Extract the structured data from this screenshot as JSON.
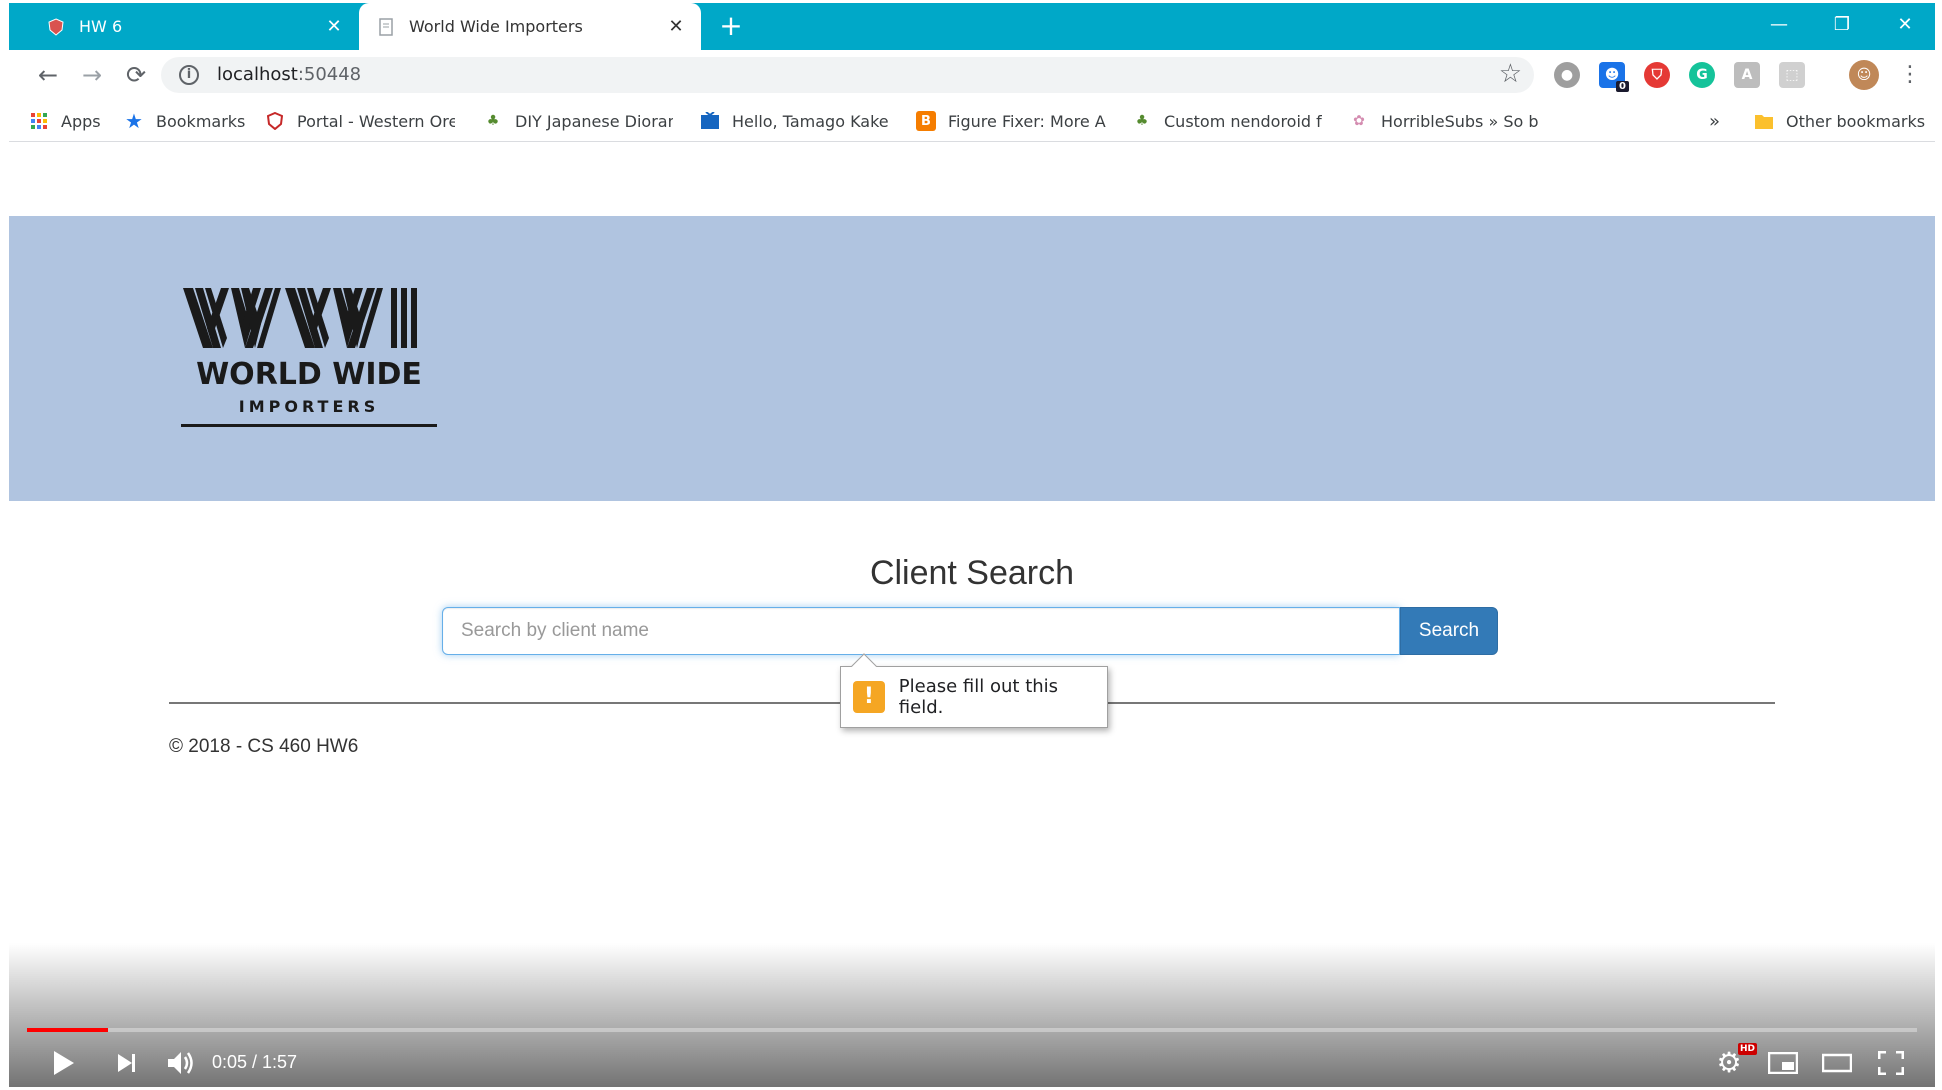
{
  "browser": {
    "tabs": [
      {
        "title": "HW 6",
        "active": false
      },
      {
        "title": "World Wide Importers",
        "active": true
      }
    ],
    "new_tab_symbol": "+",
    "window_controls": {
      "minimize": "—",
      "restore": "❐",
      "close": "✕"
    },
    "address_bar": {
      "host": "localhost",
      "port": ":50448"
    },
    "bookmarks": [
      {
        "label": "Apps",
        "icon": "apps-grid-icon"
      },
      {
        "label": "Bookmarks",
        "icon": "star-icon"
      },
      {
        "label": "Portal - Western Oreg",
        "icon": "portal-shield-icon"
      },
      {
        "label": "DIY Japanese Dioram",
        "icon": "figure-icon"
      },
      {
        "label": "Hello, Tamago Kake G",
        "icon": "tv-icon"
      },
      {
        "label": "Figure Fixer: More Ab",
        "icon": "blogger-icon"
      },
      {
        "label": "Custom nendoroid fa",
        "icon": "figure-icon"
      },
      {
        "label": "HorribleSubs » So ba",
        "icon": "horriblesubs-icon"
      }
    ],
    "bookmarks_overflow": "»",
    "other_bookmarks": "Other bookmarks",
    "extension_badge": "0"
  },
  "page": {
    "logo": {
      "initials": "WWI",
      "line1": "WORLD WIDE",
      "line2": "IMPORTERS"
    },
    "search": {
      "title": "Client Search",
      "placeholder": "Search by client name",
      "button_label": "Search"
    },
    "validation_message": "Please fill out this field.",
    "footer": "© 2018 - CS 460 HW6"
  },
  "video_player": {
    "current_time": "0:05",
    "duration": "1:57",
    "time_display": "0:05 / 1:57",
    "progress": 0.043,
    "hd_badge": "HD"
  },
  "colors": {
    "tabstrip": "#00a8c8",
    "banner": "#b0c4e0",
    "search_button": "#337ab7",
    "progress": "#ff0000",
    "warning": "#f5a623"
  }
}
